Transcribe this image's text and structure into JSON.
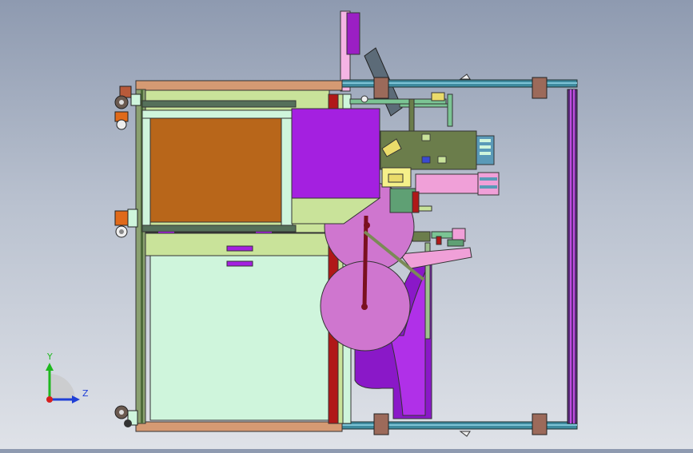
{
  "viewport": {
    "background_top": "#8e9ab0",
    "background_bottom": "#dfe2e8"
  },
  "triad": {
    "y_label": "Y",
    "z_label": "Z",
    "y_color": "#1fb81f",
    "z_color": "#1f3fd6",
    "x_color": "#d61f1f"
  },
  "colors": {
    "frame_profile": "#3e8a9e",
    "frame_edge": "#2b5f6e",
    "cabinet_green": "#c9e39a",
    "cabinet_pale": "#cff5dc",
    "brown_panel": "#b8661a",
    "wood_rail": "#d59a73",
    "purple_box": "#a420e0",
    "magenta_wheel": "#cf76cf",
    "red_rod": "#9c1212",
    "pink_part": "#f0a0d8",
    "olive_block": "#6b7d4b",
    "purple_duct": "#8a18c8"
  },
  "icons": {
    "triad": "coordinate-triad-icon",
    "caster": "caster-wheel-icon"
  }
}
